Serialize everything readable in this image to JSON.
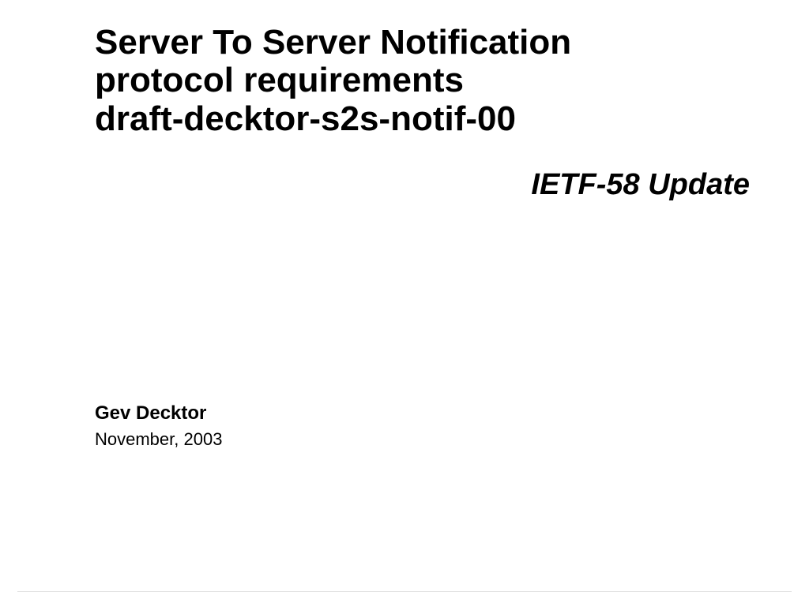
{
  "slide": {
    "title_line1": "Server To Server Notification",
    "title_line2": "protocol requirements",
    "title_line3": "draft-decktor-s2s-notif-00",
    "subtitle": "IETF-58 Update",
    "author": "Gev Decktor",
    "date": "November, 2003"
  }
}
